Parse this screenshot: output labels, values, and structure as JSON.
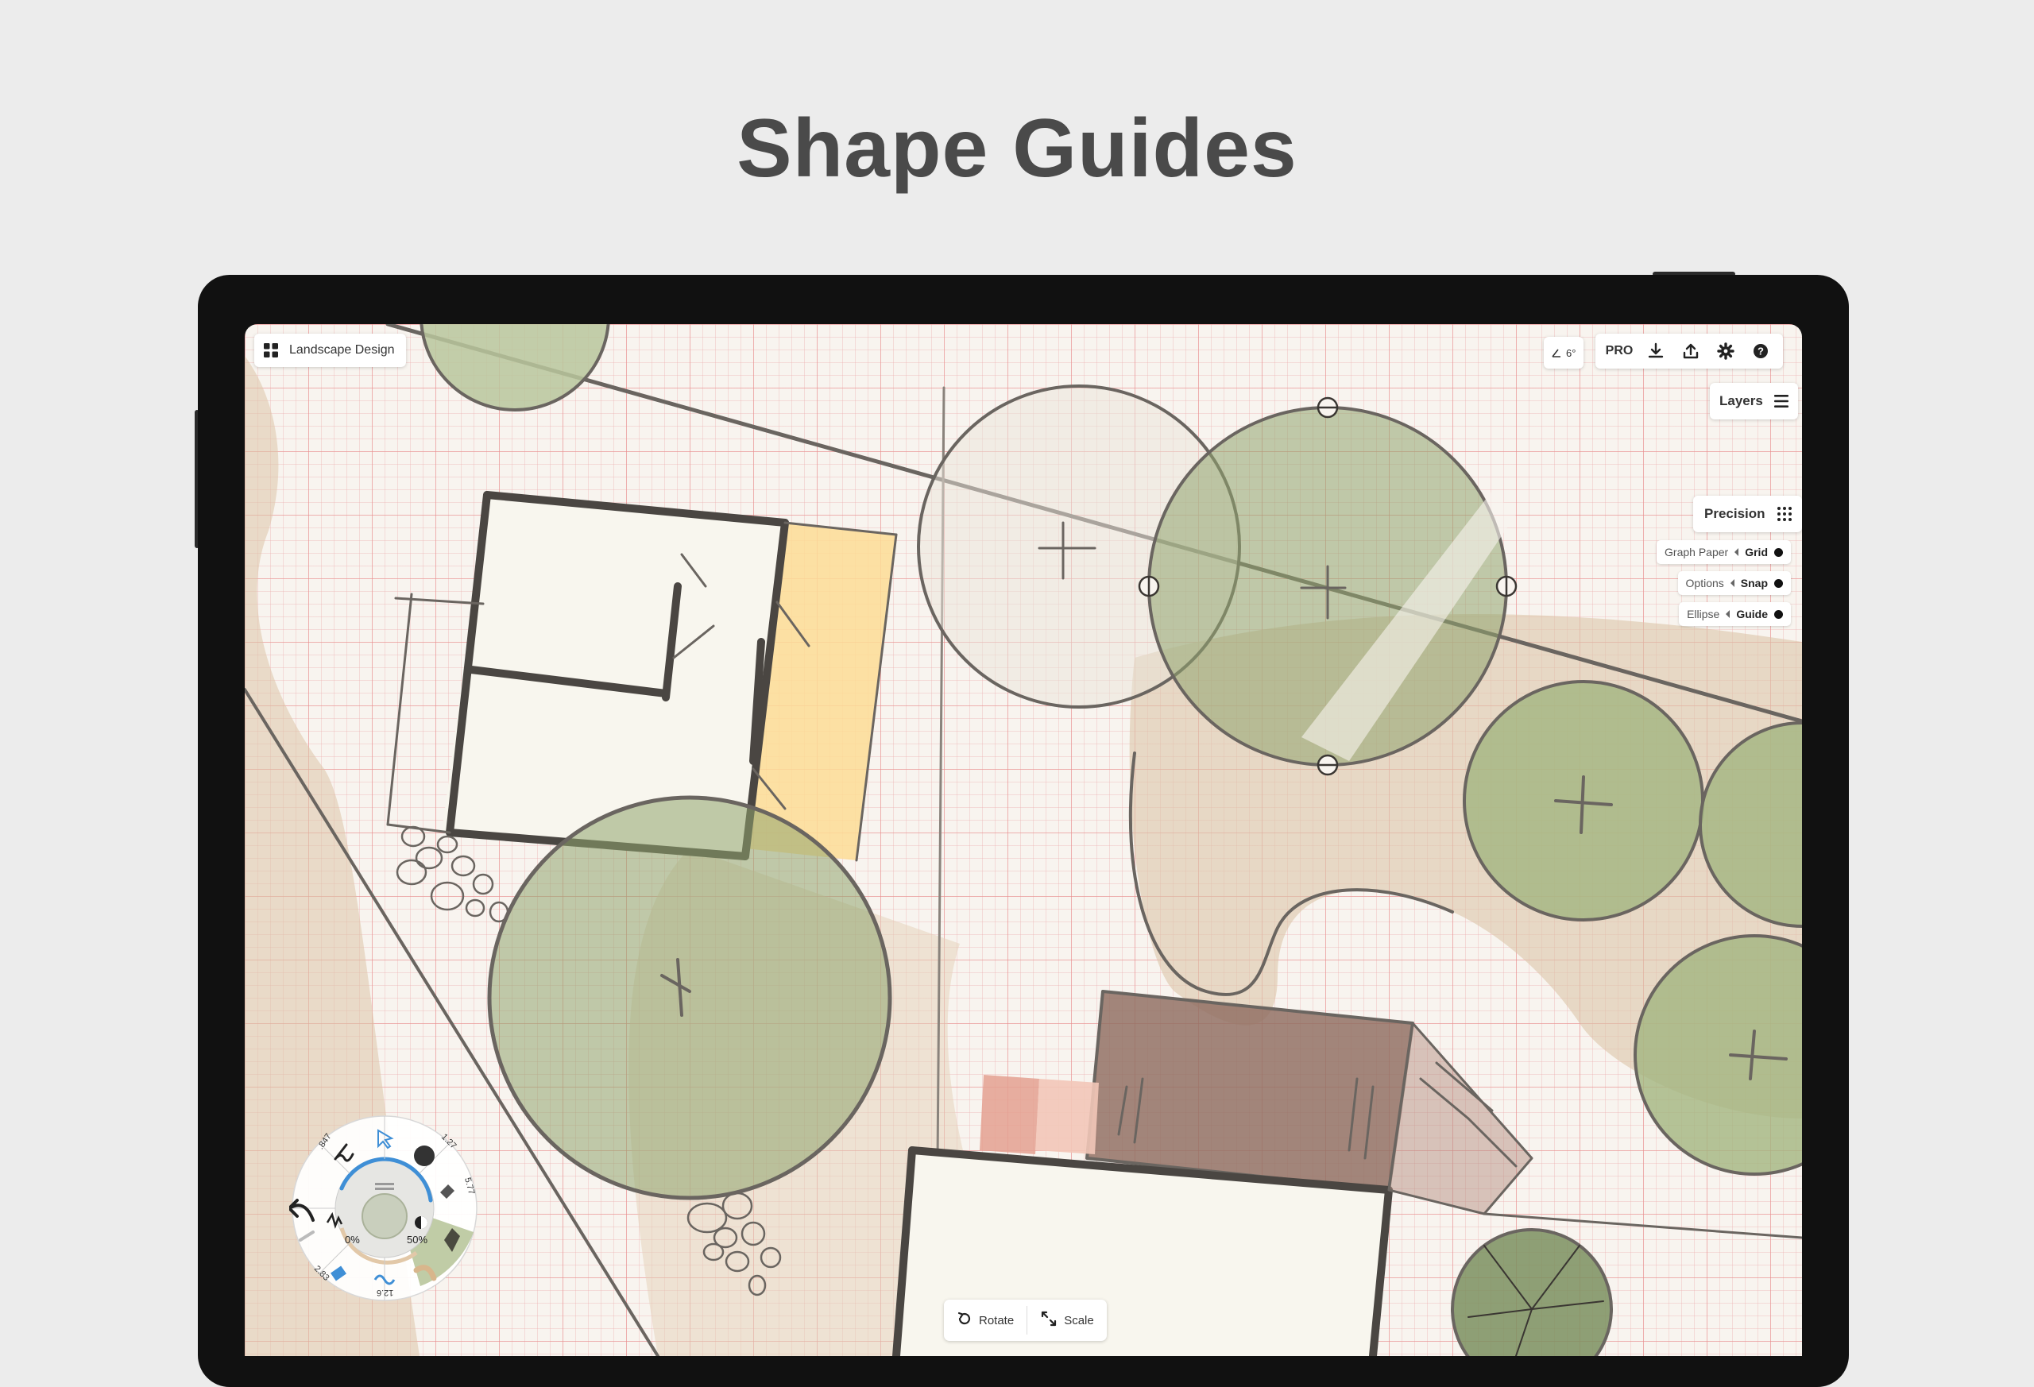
{
  "headline": "Shape Guides",
  "document": {
    "menu_icon": "grid-menu-icon",
    "title": "Landscape Design"
  },
  "toolbar": {
    "angle": "6°",
    "pro_label": "PRO",
    "icons": [
      "download-icon",
      "share-icon",
      "gear-icon",
      "help-icon"
    ]
  },
  "layers": {
    "label": "Layers",
    "icon": "layers-menu-icon"
  },
  "precision": {
    "label": "Precision",
    "icon": "dot-grid-icon",
    "rows": [
      {
        "name": "Graph Paper",
        "value": "Grid"
      },
      {
        "name": "Options",
        "value": "Snap"
      },
      {
        "name": "Ellipse",
        "value": "Guide"
      }
    ]
  },
  "transform": {
    "rotate_label": "Rotate",
    "scale_label": "Scale"
  },
  "tool_wheel": {
    "size_value": ".847",
    "opacity_value": "1.27",
    "smoothing_value": "5.77",
    "lower_left_value": "2.83",
    "lower_value": "12.6",
    "left_percent": "0%",
    "right_percent": "50%"
  },
  "colors": {
    "tree_green": "#8fa46e",
    "path_tan": "#dcc4a8",
    "deck_yellow": "#fddc95",
    "roof_brown": "#8f6c60",
    "paper": "#f8f4ef",
    "grid_red": "#e88c8c",
    "accent_blue": "#3f8fd6"
  }
}
